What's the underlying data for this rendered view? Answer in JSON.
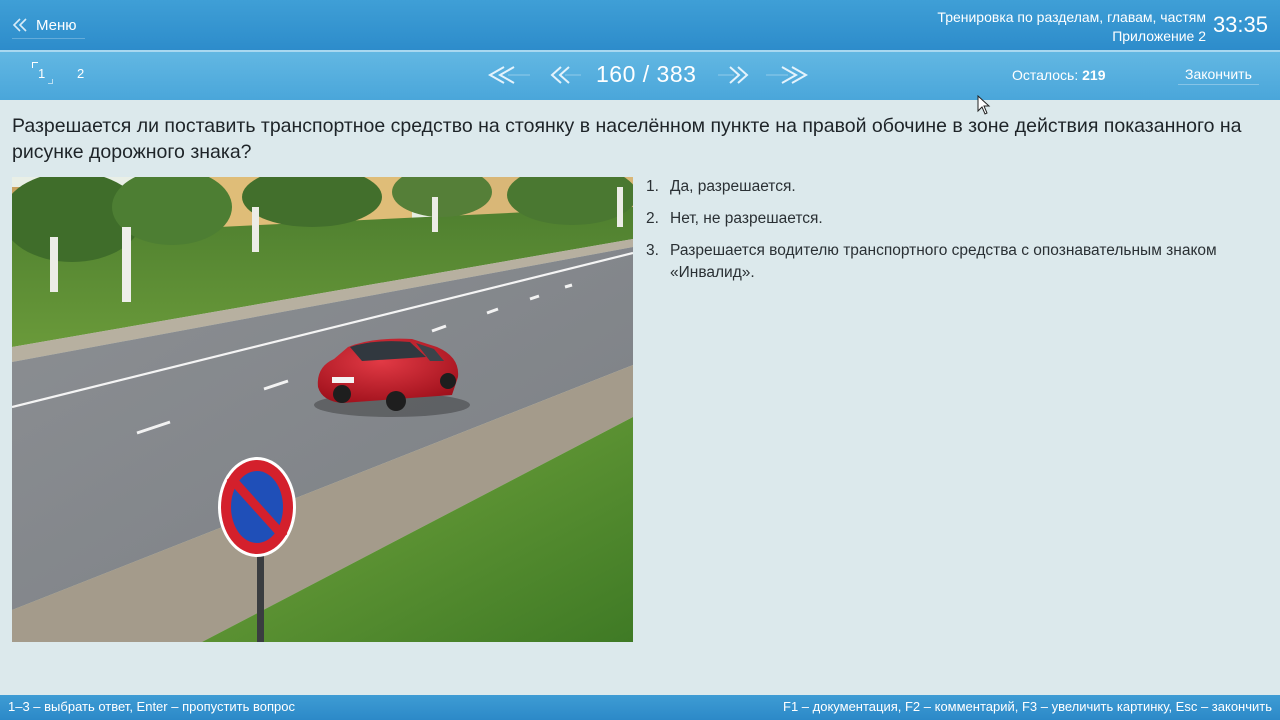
{
  "header": {
    "menu_label": "Меню",
    "mode_title": "Тренировка по разделам, главам, частям",
    "section_title": "Приложение 2",
    "timer": "33:35"
  },
  "nav": {
    "question_tabs": [
      "1",
      "2"
    ],
    "counter": "160 / 383",
    "remaining_label": "Осталось:",
    "remaining_value": "219",
    "finish_label": "Закончить"
  },
  "question": {
    "text": "Разрешается ли поставить транспортное средство на стоянку в населённом пункте на правой обочине в зоне действия показанного на рисунке дорожного знака?"
  },
  "answers": [
    {
      "num": "1.",
      "text": "Да, разрешается."
    },
    {
      "num": "2.",
      "text": "Нет, не разрешается."
    },
    {
      "num": "3.",
      "text": "Разрешается водителю транспортного средства с опознавательным знаком «Инвалид»."
    }
  ],
  "footer": {
    "left_hint": "1–3 – выбрать ответ, Enter – пропустить вопрос",
    "right_hint": "F1 – документация, F2 – комментарий, F3 – увеличить картинку, Esc – закончить"
  },
  "colors": {
    "header_bg": "#2d8ccb",
    "nav_bg": "#4aa6da",
    "page_bg": "#dce9ec",
    "sign_red": "#d4202c",
    "sign_blue": "#1f4fb8"
  },
  "icons": {
    "menu": "double-chevron-left-icon",
    "first": "double-chevron-left-icon",
    "prev": "chevron-left-icon",
    "next": "chevron-right-icon",
    "last": "double-chevron-right-icon"
  }
}
